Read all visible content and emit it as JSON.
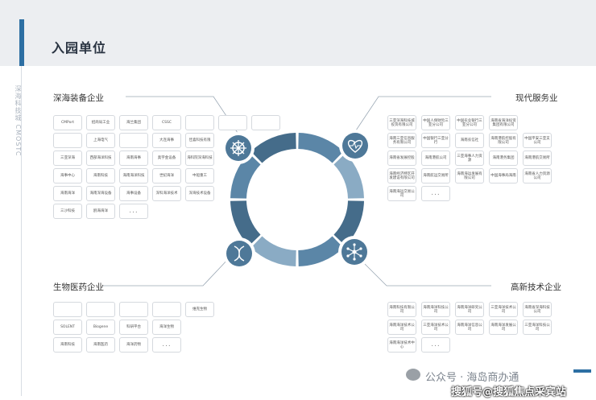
{
  "header": {
    "title": "入园单位",
    "vertical_en": "深海科技城 CMOSTC"
  },
  "categories": [
    {
      "id": "deep-sea",
      "label": "深海装备企业",
      "rows": [
        [
          "CMPort",
          "招商局工业",
          "海兰集团",
          "CSSC",
          "",
          "",
          ""
        ],
        [
          "",
          "上海电气",
          "",
          "大连海事",
          "佳喜科技有限"
        ],
        [
          "三亚深海",
          "西部海洋科技",
          "海南海事",
          "奥宇金设备",
          "海科院深海科技"
        ],
        [
          "海事中心",
          "海南科技",
          "海南海洋科技",
          "世纪海洋",
          "中船重工"
        ],
        [
          "海南海洋",
          "海南深海设备",
          "海事设备",
          "深科海洋技术",
          "深海技术设备"
        ],
        [
          "三沙科技",
          "鸥海海洋",
          "..."
        ]
      ]
    },
    {
      "id": "modern-service",
      "label": "现代服务业",
      "rows": [
        [
          "三亚深海科技城投资有限公司",
          "中国人保财险三亚分公司",
          "中国农业银行三亚分公司",
          "海南省海洋投资集团有限公司"
        ],
        [
          "海南三亚信息服务有限公司",
          "中国银行三亚分行",
          "海南农信社",
          "海南港航控股有限公司",
          "中国平安三亚支公司"
        ],
        [
          "海南省发展控股",
          "海南港航公司",
          "三亚海事人力资源",
          "海南港务集团",
          "海南港航交易所"
        ],
        [
          "海南经济特区开发建设有限公司",
          "海南航运交易所",
          "海南海运发展有限公司",
          "中国海事局海南",
          "海南省人力资源公司"
        ],
        [
          "海南海运交易公司",
          "..."
        ]
      ]
    },
    {
      "id": "biomedicine",
      "label": "生物医药企业",
      "rows": [
        [
          "",
          "",
          "",
          "",
          "维克生物"
        ],
        [
          "SOLENT",
          "Biogene",
          "科研平台",
          "海洋生物"
        ],
        [
          "海南科技",
          "海南医药",
          "海洋药物",
          "..."
        ]
      ]
    },
    {
      "id": "high-tech",
      "label": "高新技术企业",
      "rows": [
        [
          "海南科技有限公司",
          "海南海洋科技公司",
          "海南海洋研究公司",
          "三亚海洋技术公司",
          "海南省深海科技公司"
        ],
        [
          "海南海洋技术公司",
          "三亚海洋技术公司",
          "海南海洋信息公司",
          "海南海洋发展公司",
          "三亚海洋科技公司"
        ],
        [
          "海南海洋技术中心",
          "..."
        ]
      ]
    }
  ],
  "watermark": {
    "line1": "公众号 · 海岛商办通",
    "line2": "搜狐号@搜狐焦点采宾站"
  },
  "colors": {
    "ring_dark": "#456c8a",
    "ring_mid": "#5b86a7",
    "ring_light": "#8aabc4",
    "accent": "#2d6fa3",
    "icon_circle": "#4e7898"
  }
}
